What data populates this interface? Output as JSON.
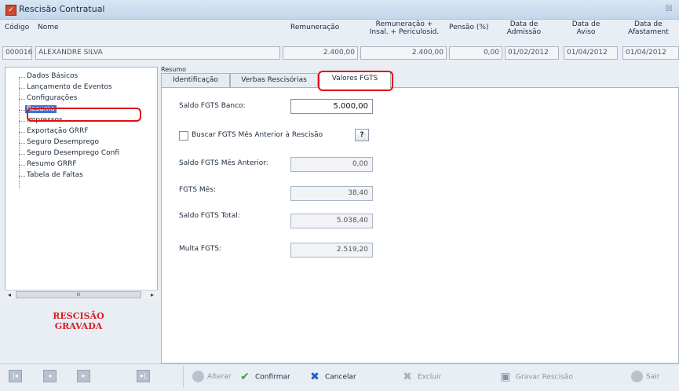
{
  "window": {
    "title": "Rescisão Contratual",
    "close_glyph": "☒"
  },
  "header": {
    "codigo_label": "Código",
    "nome_label": "Nome",
    "remuneracao_label": "Remuneração",
    "rem_insal_line1": "Remuneração +",
    "rem_insal_line2": "Insal. + Periculosid.",
    "pensao_label": "Pensão (%)",
    "admissao_line1": "Data de",
    "admissao_line2": "Admissão",
    "aviso_line1": "Data de",
    "aviso_line2": "Aviso",
    "afast_line1": "Data de",
    "afast_line2": "Afastament"
  },
  "employee": {
    "codigo": "000016",
    "nome": "ALEXANDRE SILVA",
    "remuneracao": "2.400,00",
    "rem_insal": "2.400,00",
    "pensao": "0,00",
    "admissao": "01/02/2012",
    "aviso": "01/04/2012",
    "afastamento": "01/04/2012"
  },
  "tree": {
    "items": [
      "Dados Básicos",
      "Lançamento de Eventos",
      "Configurações",
      "Resumo",
      "Impressos",
      "Exportação GRRF",
      "Seguro Desemprego",
      "Seguro Desemprego Confi",
      "Resumo GRRF",
      "Tabela de Faltas"
    ],
    "selected": "Resumo",
    "scroll_thumb": "III"
  },
  "status": {
    "line1": "RESCISÃO",
    "line2": "GRAVADA",
    "color": "#d61f1f"
  },
  "panel": {
    "title": "Resumo",
    "tabs": [
      "Identificação",
      "Verbas Rescisórias",
      "Valores FGTS"
    ],
    "active_tab": "Valores FGTS"
  },
  "fgts": {
    "saldo_banco_label": "Saldo FGTS Banco:",
    "saldo_banco": "5.000,00",
    "buscar_label": "Buscar FGTS Mês Anterior à Rescisão",
    "buscar_checked": false,
    "help_label": "?",
    "saldo_anterior_label": "Saldo FGTS Mês Anterior:",
    "saldo_anterior": "0,00",
    "fgts_mes_label": "FGTS Mês:",
    "fgts_mes": "38,40",
    "saldo_total_label": "Saldo FGTS Total:",
    "saldo_total": "5.038,40",
    "multa_label": "Multa FGTS:",
    "multa": "2.519,20"
  },
  "toolbar": {
    "nav": [
      "|◂",
      "◂",
      "▸",
      "▸|"
    ],
    "alterar": "Alterar",
    "confirmar": "Confirmar",
    "cancelar": "Cancelar",
    "excluir": "Excluir",
    "gravar": "Gravar Rescisão",
    "sair": "Sair"
  },
  "colors": {
    "highlight": "#e01010",
    "selection": "#3875d7"
  }
}
